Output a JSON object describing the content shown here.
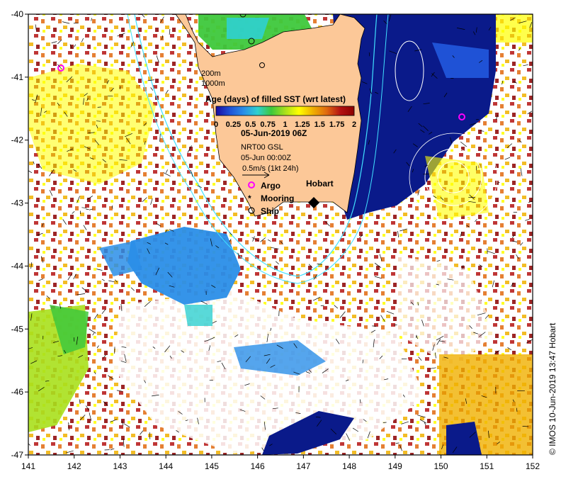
{
  "map": {
    "lon_range": [
      141,
      152
    ],
    "lat_range": [
      -47,
      -40
    ],
    "x_ticks": [
      "141",
      "142",
      "143",
      "144",
      "145",
      "146",
      "147",
      "148",
      "149",
      "150",
      "151",
      "152"
    ],
    "y_ticks": [
      "-40",
      "-41",
      "-42",
      "-43",
      "-44",
      "-45",
      "-46",
      "-47"
    ]
  },
  "legend": {
    "depth_200": "200m",
    "depth_1000": "1000m",
    "colorbar_title": "Age (days) of filled SST (wrt latest)",
    "colorbar_ticks": [
      "0",
      "0.25",
      "0.5",
      "0.75",
      "1",
      "1.25",
      "1.5",
      "1.75",
      "2"
    ],
    "colorbar_colors": [
      "#1a0aa0",
      "#1f52d6",
      "#2a8ee8",
      "#2fd0d0",
      "#3ec83c",
      "#a8e01c",
      "#ffff00",
      "#f0b000",
      "#e06a10",
      "#b41212",
      "#8c0000"
    ],
    "date_title": "05-Jun-2019 06Z",
    "product": "NRT00 GSL",
    "time": "05-Jun 00:00Z",
    "scale": "0.5m/s (1kt 24h)",
    "argo": "Argo",
    "mooring": "Mooring",
    "ship": "Ship",
    "city": "Hobart"
  },
  "credit": "© IMOS 10-Jun-2019 13:47 Hobart",
  "colors": {
    "land": "#fcc898",
    "deep_blue": "#0a1a8a",
    "argo": "#ff00ff",
    "isobath": "#40e0ff"
  }
}
